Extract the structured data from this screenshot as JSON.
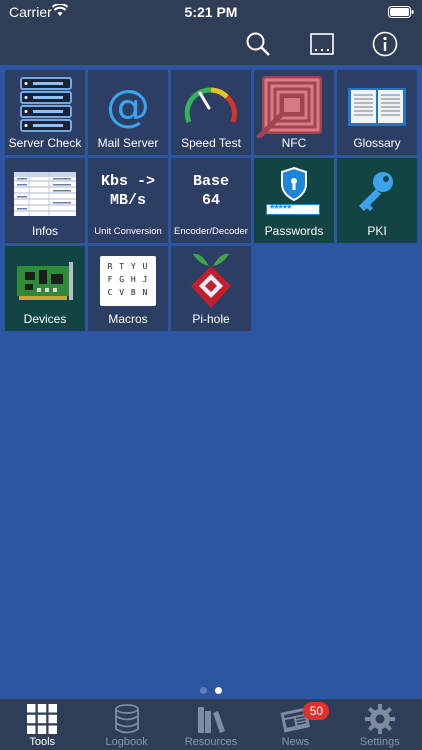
{
  "status": {
    "carrier": "Carrier",
    "time": "5:21 PM"
  },
  "navbar": {
    "icons": [
      "search-icon",
      "console-icon",
      "info-icon"
    ]
  },
  "tiles": [
    {
      "id": "server-check",
      "label": "Server Check",
      "icon": "server-rack-icon"
    },
    {
      "id": "mail-server",
      "label": "Mail Server",
      "icon": "at-sign-icon",
      "glyph": "@"
    },
    {
      "id": "speed-test",
      "label": "Speed Test",
      "icon": "speedometer-icon"
    },
    {
      "id": "nfc",
      "label": "NFC",
      "icon": "nfc-icon"
    },
    {
      "id": "glossary",
      "label": "Glossary",
      "icon": "open-book-icon"
    },
    {
      "id": "infos",
      "label": "Infos",
      "icon": "table-icon"
    },
    {
      "id": "unit-conversion",
      "label": "Unit Conversion",
      "icon": "conversion-text-icon",
      "line1": "Kbs ->",
      "line2": "MB/s"
    },
    {
      "id": "encoder-decoder",
      "label": "Encoder/Decoder",
      "icon": "base64-text-icon",
      "line1": "Base",
      "line2": "64"
    },
    {
      "id": "passwords",
      "label": "Passwords",
      "icon": "password-shield-icon",
      "field": "*****"
    },
    {
      "id": "pki",
      "label": "PKI",
      "icon": "key-icon"
    },
    {
      "id": "devices",
      "label": "Devices",
      "icon": "circuit-board-icon"
    },
    {
      "id": "macros",
      "label": "Macros",
      "icon": "keyboard-icon",
      "keys1": "R T Y U",
      "keys2": "F G H J",
      "keys3": "C V B N"
    },
    {
      "id": "pi-hole",
      "label": "Pi-hole",
      "icon": "pi-hole-logo-icon"
    }
  ],
  "pager": {
    "count": 2,
    "active": 1
  },
  "tabs": [
    {
      "label": "Tools",
      "icon": "grid-icon",
      "active": true
    },
    {
      "label": "Logbook",
      "icon": "database-icon",
      "active": false
    },
    {
      "label": "Resources",
      "icon": "books-icon",
      "active": false
    },
    {
      "label": "News",
      "icon": "newspaper-icon",
      "active": false,
      "badge": "50"
    },
    {
      "label": "Settings",
      "icon": "gear-icon",
      "active": false
    }
  ],
  "colors": {
    "background": "#2c56a2",
    "bars": "#2f3d56",
    "tile": "#2c3e63",
    "tile_green": "#134444",
    "badge": "#e1302d"
  }
}
